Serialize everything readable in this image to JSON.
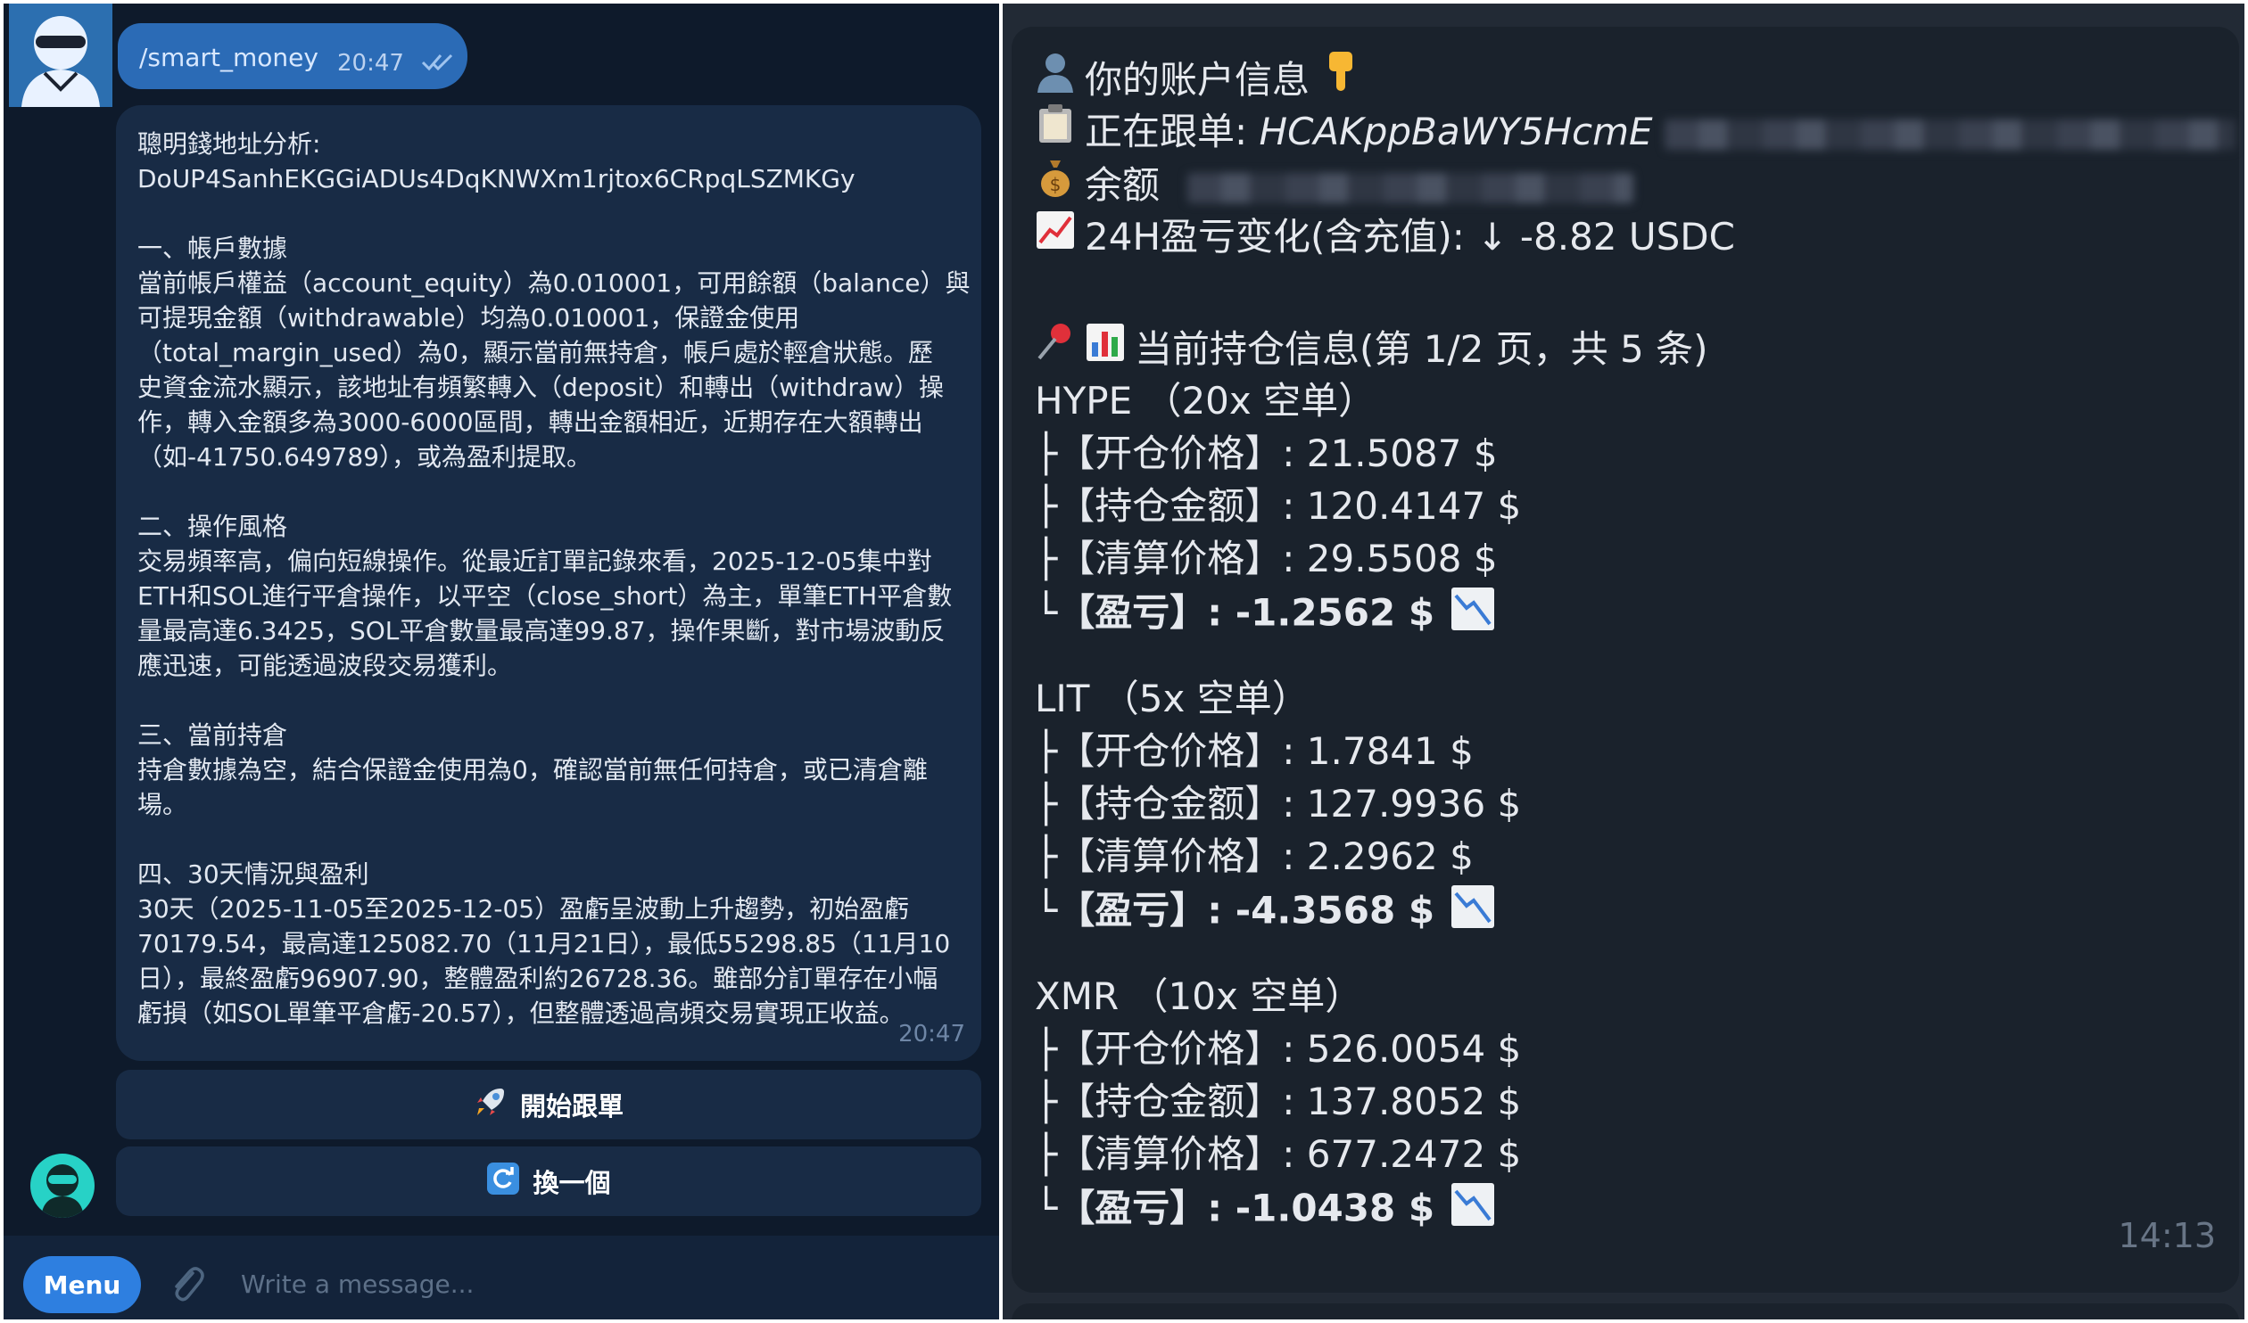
{
  "left_chat": {
    "command_message": {
      "text": "/smart_money",
      "time": "20:47"
    },
    "analysis_message": {
      "time": "20:47",
      "paragraphs": [
        [
          "聰明錢地址分析:",
          "DoUP4SanhEKGGiADUs4DqKNWXm1rjtox6CRpqLSZMKGy"
        ],
        [
          "一、帳戶數據",
          "當前帳戶權益（account_equity）為0.010001，可用餘額（balance）與",
          "可提現金額（withdrawable）均為0.010001，保證金使用",
          "（total_margin_used）為0，顯示當前無持倉，帳戶處於輕倉狀態。歷",
          "史資金流水顯示，該地址有頻繁轉入（deposit）和轉出（withdraw）操",
          "作，轉入金額多為3000-6000區間，轉出金額相近，近期存在大額轉出",
          "（如-41750.649789），或為盈利提取。"
        ],
        [
          "二、操作風格",
          "交易頻率高，偏向短線操作。從最近訂單記錄來看，2025-12-05集中對",
          "ETH和SOL進行平倉操作，以平空（close_short）為主，單筆ETH平倉數",
          "量最高達6.3425，SOL平倉數量最高達99.87，操作果斷，對市場波動反",
          "應迅速，可能透過波段交易獲利。"
        ],
        [
          "三、當前持倉",
          "持倉數據為空，結合保證金使用為0，確認當前無任何持倉，或已清倉離",
          "場。"
        ],
        [
          "四、30天情況與盈利",
          "30天（2025-11-05至2025-12-05）盈虧呈波動上升趨勢，初始盈虧",
          "70179.54，最高達125082.70（11月21日），最低55298.85（11月10",
          "日），最終盈虧96907.90，整體盈利約26728.36。雖部分訂單存在小幅",
          "虧損（如SOL單筆平倉虧-20.57），但整體透過高頻交易實現正收益。"
        ]
      ]
    },
    "buttons": {
      "start_copy": "開始跟單",
      "switch_one": "換一個"
    },
    "composer": {
      "menu_label": "Menu",
      "placeholder": "Write a message..."
    }
  },
  "right_chat": {
    "account": {
      "title": "你的账户信息",
      "following_label": "正在跟单:",
      "following_address": "HCAKppBaWY5HcmE",
      "balance_label": "余额",
      "pnl_change": "24H盈亏变化(含充值): ↓ -8.82 USDC"
    },
    "positions_header": "当前持仓信息(第 1/2 页，共 5 条)",
    "positions": [
      {
        "header": "HYPE （20x 空单）",
        "open_price": "├【开仓价格】: 21.5087 $",
        "amount": "├【持仓金额】: 120.4147 $",
        "liq_price": "├【清算价格】: 29.5508 $",
        "pnl": "└【盈亏】: -1.2562 $"
      },
      {
        "header": "LIT （5x 空单）",
        "open_price": "├【开仓价格】: 1.7841 $",
        "amount": "├【持仓金额】: 127.9936 $",
        "liq_price": "├【清算价格】: 2.2962 $",
        "pnl": "└【盈亏】: -4.3568 $"
      },
      {
        "header": "XMR （10x 空单）",
        "open_price": "├【开仓价格】: 526.0054 $",
        "amount": "├【持仓金额】: 137.8052 $",
        "liq_price": "├【清算价格】: 677.2472 $",
        "pnl": "└【盈亏】: -1.0438 $"
      }
    ],
    "time": "14:13"
  },
  "icons": [
    "bust-icon",
    "clipboard-icon",
    "money-bag-icon",
    "chart-up-icon",
    "pushpin-icon",
    "bar-chart-icon",
    "chart-down-icon",
    "rocket-icon",
    "refresh-icon",
    "paperclip-icon",
    "double-check-icon"
  ],
  "colors": {
    "accent": "#2e7fe0",
    "left_bg": "#0e1a2b",
    "bubble": "#182b45",
    "right_bg": "#1a222c"
  }
}
